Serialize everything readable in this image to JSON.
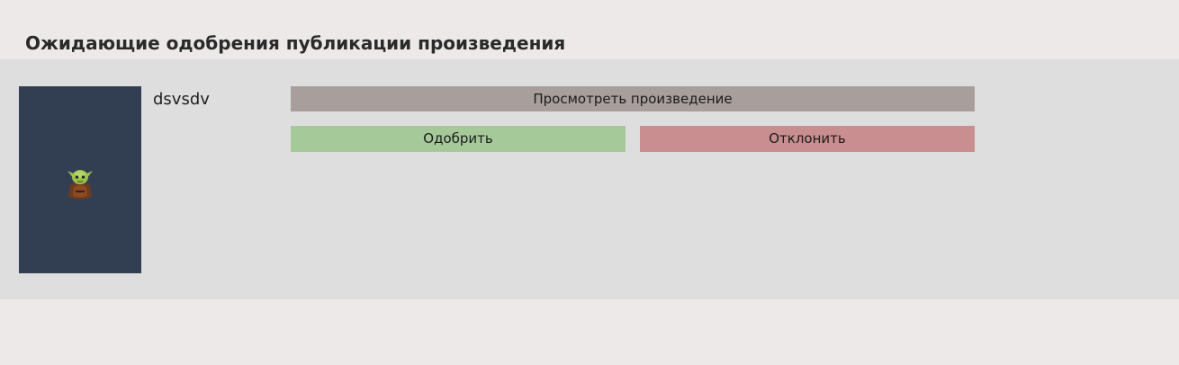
{
  "header": {
    "title": "Ожидающие одобрения публикации произведения"
  },
  "pending_items": [
    {
      "cover_icon": "goblin-character-image",
      "title": "dsvsdv",
      "view_label": "Просмотреть произведение",
      "approve_label": "Одобрить",
      "reject_label": "Отклонить"
    }
  ],
  "colors": {
    "background": "#ede9e8",
    "panel": "#dfdedf",
    "cover": "#323f53",
    "view_button": "#a89e9c",
    "approve_button": "#a6c99a",
    "reject_button": "#c98f90"
  }
}
